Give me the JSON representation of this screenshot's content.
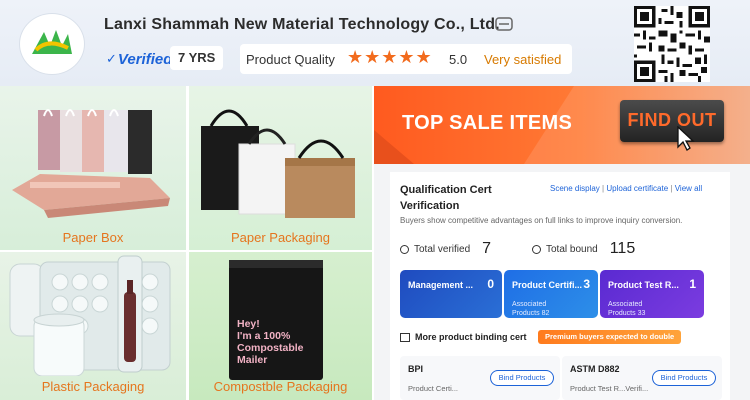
{
  "header": {
    "company_name": "Lanxi Shammah New Material Technology Co., Ltd.",
    "verified_label": "Verified",
    "years": "7 YRS",
    "quality_label": "Product Quality",
    "stars": "★★★★★",
    "rating": "5.0",
    "satisfaction": "Very satisfied"
  },
  "tiles": [
    {
      "caption": "Paper Box"
    },
    {
      "caption": "Paper Packaging"
    },
    {
      "caption": "Plastic Packaging"
    },
    {
      "caption": "Compostble Packaging"
    }
  ],
  "mailer_text": [
    "Hey!",
    "I'm a 100%",
    "Compostable",
    "Mailer"
  ],
  "banner": {
    "title": "TOP SALE ITEMS",
    "cta": "FIND OUT"
  },
  "qualification": {
    "title": "Qualification Cert Verification",
    "link_scene": "Scene display",
    "link_upload": "Upload certificate",
    "link_view": "View all",
    "description": "Buyers show competitive advantages on full links to improve inquiry conversion.",
    "total_verified_label": "Total verified",
    "total_verified": "7",
    "total_bound_label": "Total bound",
    "total_bound": "115",
    "pills": [
      {
        "title": "Management ...",
        "count": "0",
        "sub1": "",
        "sub2": ""
      },
      {
        "title": "Product Certifi...",
        "count": "3",
        "sub1": "Associated",
        "sub2": "Products  82"
      },
      {
        "title": "Product Test R...",
        "count": "1",
        "sub1": "Associated",
        "sub2": "Products  33"
      }
    ],
    "more_label": "More product binding cert",
    "premium_badge": "Premium buyers expected to double",
    "bind_cards": [
      {
        "name": "BPI",
        "sub": "Product Certi... ",
        "button": "Bind Products"
      },
      {
        "name": "ASTM D882",
        "sub": "Product Test R...Verifi...",
        "button": "Bind Products"
      }
    ]
  },
  "colors": {
    "accent_orange": "#f26b1d",
    "brand_blue": "#1d63d8"
  }
}
